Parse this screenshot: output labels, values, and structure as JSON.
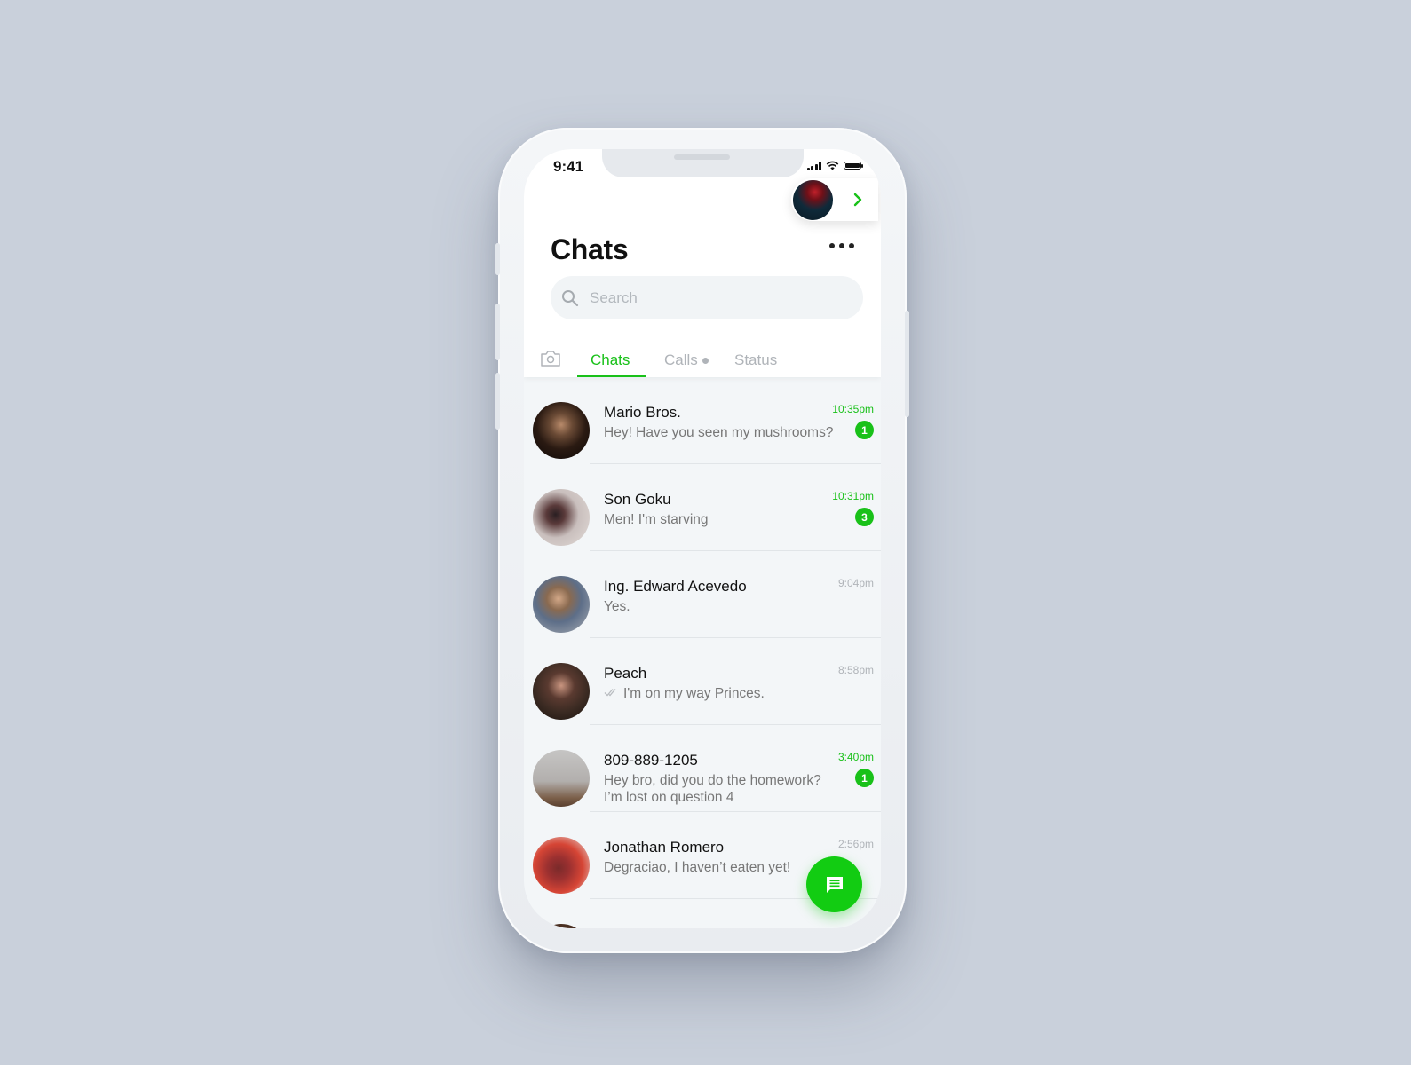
{
  "status_bar": {
    "time": "9:41"
  },
  "header": {
    "title": "Chats",
    "more_icon": "more-horizontal-icon",
    "profile_chevron_icon": "chevron-right-icon"
  },
  "search": {
    "placeholder": "Search",
    "value": "",
    "icon": "search-icon"
  },
  "tabs": {
    "camera_icon": "camera-icon",
    "items": [
      {
        "label": "Chats",
        "active": true
      },
      {
        "label": "Calls",
        "active": false,
        "has_dot": true
      },
      {
        "label": "Status",
        "active": false
      }
    ]
  },
  "chats": [
    {
      "name": "Mario Bros.",
      "preview": "Hey! Have you seen my mushrooms?",
      "time": "10:35pm",
      "unread": 1
    },
    {
      "name": "Son Goku",
      "preview": "Men! I'm starving",
      "time": "10:31pm",
      "unread": 3
    },
    {
      "name": "Ing. Edward Acevedo",
      "preview": "Yes.",
      "time": "9:04pm",
      "unread": 0
    },
    {
      "name": "Peach",
      "preview": "I'm on my way Princes.",
      "time": "8:58pm",
      "unread": 0,
      "read_receipt": "double-check-icon"
    },
    {
      "name": "809-889-1205",
      "preview": "Hey bro, did you do the homework? I’m lost on question 4",
      "time": "3:40pm",
      "unread": 1
    },
    {
      "name": "Jonathan Romero",
      "preview": "Degraciao, I haven’t eaten yet!",
      "time": "2:56pm",
      "unread": 0
    }
  ],
  "fab": {
    "icon": "new-message-icon"
  },
  "colors": {
    "accent": "#19c119",
    "fab": "#12cc12",
    "background": "#c9d0db"
  }
}
